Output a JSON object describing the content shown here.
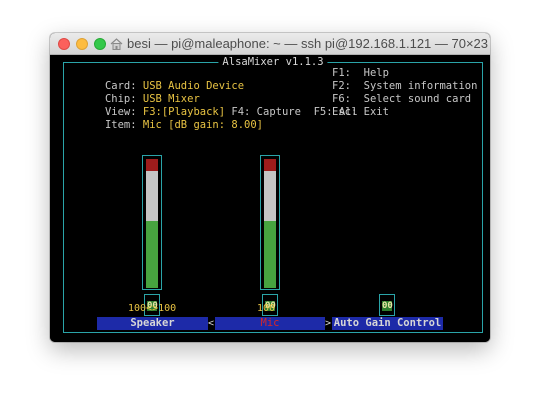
{
  "window": {
    "title": "besi — pi@maleaphone: ~ — ssh pi@192.168.1.121 — 70×23"
  },
  "mixer": {
    "app_title": "AlsaMixer v1.1.3",
    "info": {
      "card_key": "Card:",
      "card_value": "USB Audio Device",
      "chip_key": "Chip:",
      "chip_value": "USB Mixer",
      "view_key": "View:",
      "view_f3": "F3:[Playback]",
      "view_f4": "F4: Capture",
      "view_f5": "F5: All",
      "item_key": "Item:",
      "item_value": "Mic [dB gain: 8.00]"
    },
    "help": [
      {
        "key": "F1:",
        "label": "Help"
      },
      {
        "key": "F2:",
        "label": "System information"
      },
      {
        "key": "F6:",
        "label": "Select sound card"
      },
      {
        "key": "Esc:",
        "label": "Exit"
      }
    ],
    "channels": [
      {
        "name": "Speaker",
        "volume": "100<>100",
        "mute_label": "00",
        "level_percent": 100,
        "active": false
      },
      {
        "name": "Mic",
        "volume": "100",
        "mute_label": "00",
        "level_percent": 100,
        "active": true
      },
      {
        "name": "Auto Gain Control",
        "volume": "",
        "mute_label": "00",
        "level_percent": null,
        "active": false
      }
    ],
    "nav_left": "<",
    "nav_right": ">"
  },
  "colors": {
    "frame": "#2aa4a8",
    "value_text": "#e8c343",
    "channel_bg": "#1d2aa8",
    "active_channel_text": "#d6262b",
    "meter_red": "#9e1c1c",
    "meter_white": "#c5c5c5",
    "meter_green": "#47a33f"
  }
}
